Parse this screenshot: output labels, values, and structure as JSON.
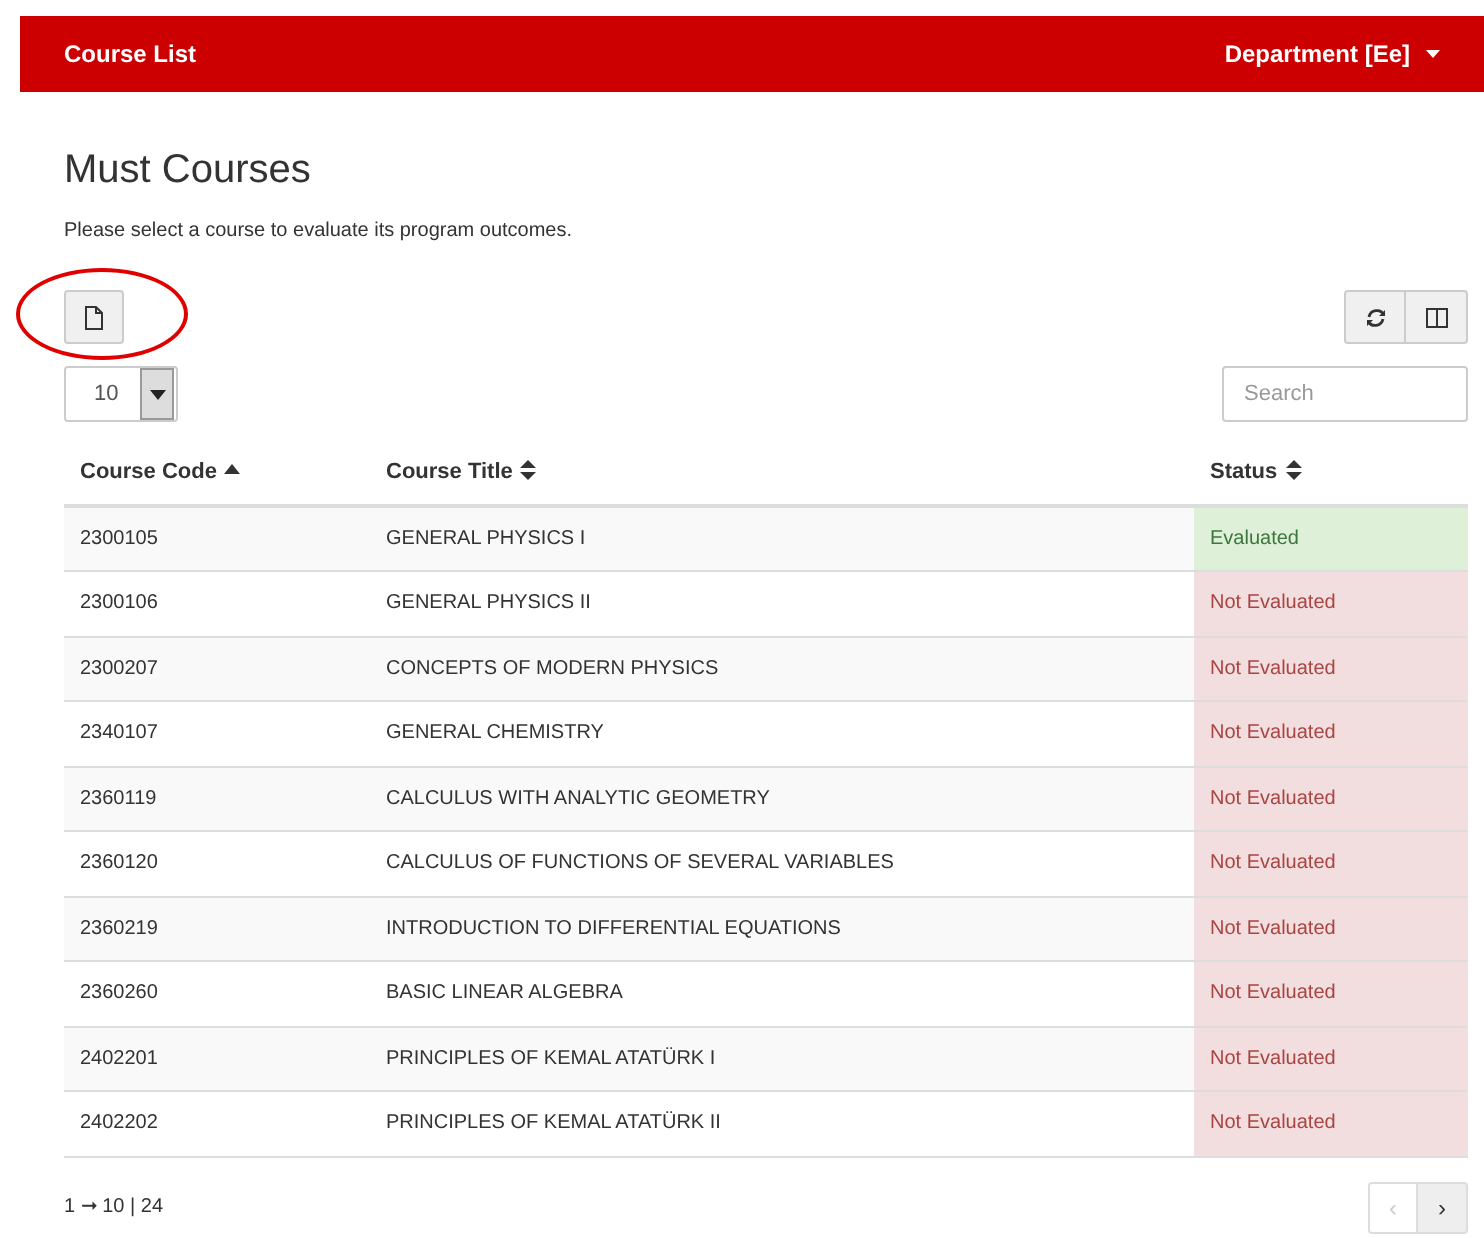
{
  "navbar": {
    "brand": "Course List",
    "menu": "Department [Ee]"
  },
  "heading": "Must Courses",
  "description": "Please select a course to evaluate its program outcomes.",
  "toolbar": {
    "export_highlighted": true,
    "page_size": "10",
    "search": {
      "placeholder": "Search"
    }
  },
  "table": {
    "columns": [
      {
        "label": "Course Code",
        "sorted_ascending": true
      },
      {
        "label": "Course Title",
        "sorted_ascending": false
      },
      {
        "label": "Status",
        "sorted_ascending": false
      }
    ],
    "rows": [
      {
        "code": "2300105",
        "title": "GENERAL PHYSICS I",
        "status": "Evaluated",
        "kind": "evaluated"
      },
      {
        "code": "2300106",
        "title": "GENERAL PHYSICS II",
        "status": "Not Evaluated",
        "kind": "not_evaluated"
      },
      {
        "code": "2300207",
        "title": "CONCEPTS OF MODERN PHYSICS",
        "status": "Not Evaluated",
        "kind": "not_evaluated"
      },
      {
        "code": "2340107",
        "title": "GENERAL CHEMISTRY",
        "status": "Not Evaluated",
        "kind": "not_evaluated"
      },
      {
        "code": "2360119",
        "title": "CALCULUS WITH ANALYTIC GEOMETRY",
        "status": "Not Evaluated",
        "kind": "not_evaluated"
      },
      {
        "code": "2360120",
        "title": "CALCULUS OF FUNCTIONS OF SEVERAL VARIABLES",
        "status": "Not Evaluated",
        "kind": "not_evaluated"
      },
      {
        "code": "2360219",
        "title": "INTRODUCTION TO DIFFERENTIAL EQUATIONS",
        "status": "Not Evaluated",
        "kind": "not_evaluated"
      },
      {
        "code": "2360260",
        "title": "BASIC LINEAR ALGEBRA",
        "status": "Not Evaluated",
        "kind": "not_evaluated"
      },
      {
        "code": "2402201",
        "title": "PRINCIPLES OF KEMAL ATATÜRK I",
        "status": "Not Evaluated",
        "kind": "not_evaluated"
      },
      {
        "code": "2402202",
        "title": "PRINCIPLES OF KEMAL ATATÜRK II",
        "status": "Not Evaluated",
        "kind": "not_evaluated"
      }
    ]
  },
  "pagination": {
    "summary": "1 ➞ 10 | 24",
    "prev": {
      "label": "‹",
      "disabled": true
    },
    "next": {
      "label": "›",
      "disabled": false
    }
  }
}
